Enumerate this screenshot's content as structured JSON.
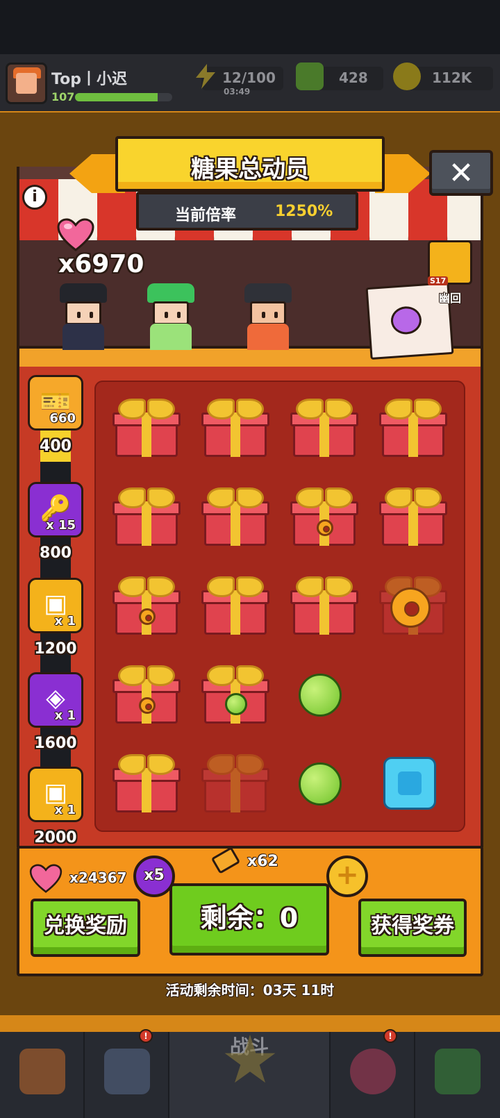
{
  "player": {
    "name": "Top丨小迟",
    "level": "107",
    "xp_fraction": 0.85
  },
  "resources": {
    "energy": "12/100",
    "energy_timer": "03:49",
    "gems": "428",
    "coins": "112K"
  },
  "event": {
    "title": "糖果总动员",
    "rate_label": "当前倍率",
    "rate_value": "1250%",
    "hearts_count": "x6970",
    "hero_tag": "S17",
    "hero_name": "幽回"
  },
  "rewards": [
    {
      "icon": "ticket-icon",
      "qty": "660",
      "cost": "400",
      "color": "#f6a82a"
    },
    {
      "icon": "key-icon",
      "qty": "x 15",
      "cost": "800",
      "color": "#8a2fd2"
    },
    {
      "icon": "chest-icon",
      "qty": "x 1",
      "cost": "1200",
      "color": "#f4b21b"
    },
    {
      "icon": "hero-chest-icon",
      "qty": "x 1",
      "cost": "1600",
      "color": "#8a2fd2"
    },
    {
      "icon": "gold-chest-icon",
      "qty": "x 1",
      "cost": "2000",
      "color": "#f4b21b"
    }
  ],
  "track_progress_fraction": 0.17,
  "grid": [
    [
      "gift",
      "gift",
      "gift",
      "gift"
    ],
    [
      "gift",
      "gift",
      "gift-donut",
      "gift"
    ],
    [
      "gift-donut",
      "gift",
      "gift",
      "donut"
    ],
    [
      "gift-donut",
      "gift-green",
      "green",
      "empty"
    ],
    [
      "gift",
      "gift-faded",
      "green",
      "blue"
    ]
  ],
  "panel": {
    "hearts_total": "x24367",
    "multiplier": "x5",
    "tickets": "x62",
    "redeem_label": "兑换奖励",
    "draw_label": "剩余：0",
    "get_tickets_label": "获得奖券",
    "time_left": "活动剩余时间：03天 11时"
  },
  "nav": {
    "battle_label": "战斗"
  },
  "colors": {
    "accent": "#f6cf30",
    "button_green": "#82d62a",
    "panel_orange": "#f4941a"
  }
}
